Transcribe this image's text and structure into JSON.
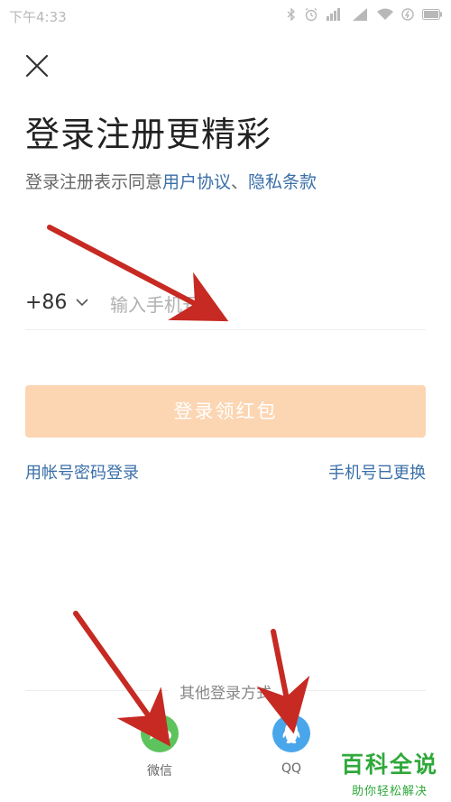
{
  "status_bar": {
    "time": "下午4:33",
    "icons": [
      "bluetooth-icon",
      "alarm-icon",
      "signal-4g-icon",
      "signal-icon",
      "wifi-icon",
      "battery-saver-icon",
      "battery-charging-icon"
    ]
  },
  "header": {
    "close_icon": "close-icon",
    "title": "登录注册更精彩"
  },
  "agreement": {
    "prefix": "登录注册表示同意",
    "user_agreement": "用户协议",
    "separator": "、",
    "privacy_policy": "隐私条款"
  },
  "phone": {
    "country_code": "+86",
    "placeholder": "输入手机号"
  },
  "login_button": {
    "label": "登录领红包"
  },
  "links": {
    "password_login": "用帐号密码登录",
    "phone_changed": "手机号已更换"
  },
  "other_login": {
    "label": "其他登录方式",
    "options": [
      {
        "name": "微信",
        "icon": "wechat-icon",
        "color": "#5dc35c"
      },
      {
        "name": "QQ",
        "icon": "qq-icon",
        "color": "#4aa6ea"
      }
    ]
  },
  "watermark": {
    "title": "百科全说",
    "subtitle": "助你轻松解决",
    "color": "#2fa83a"
  },
  "colors": {
    "accent_link": "#3a6fa8",
    "button_disabled": "#fcd5b2",
    "annotation_arrow": "#c62a22"
  }
}
